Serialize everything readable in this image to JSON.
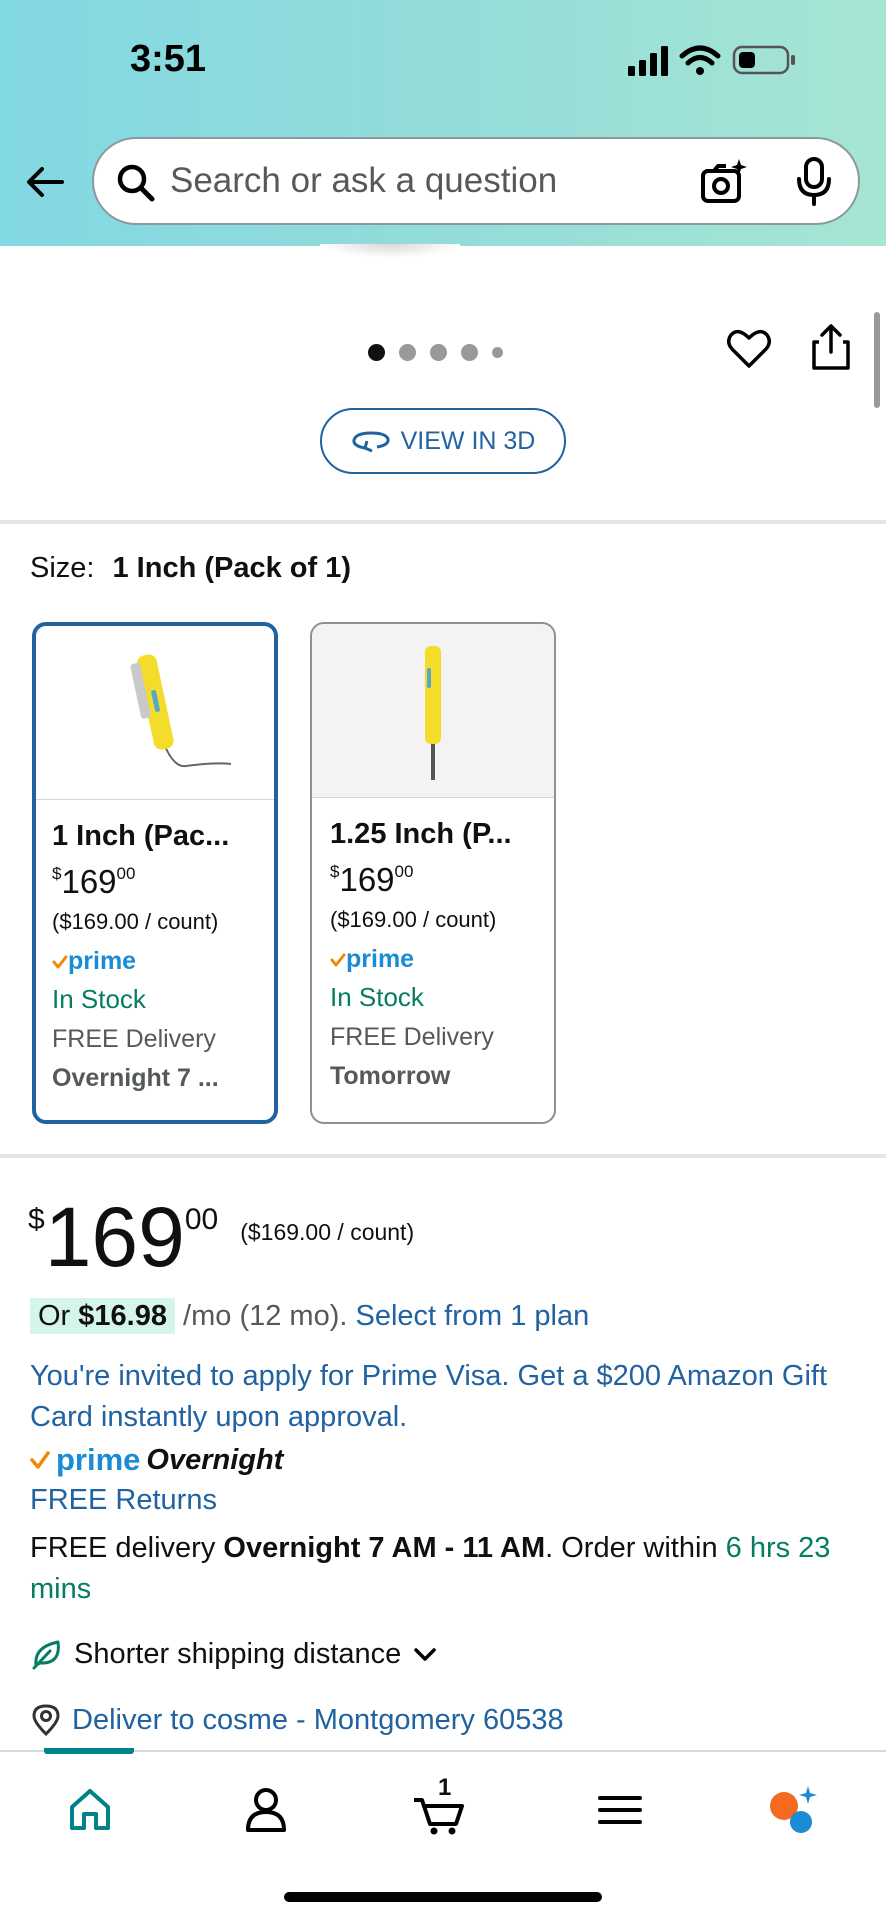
{
  "status_bar": {
    "time": "3:51"
  },
  "search": {
    "placeholder": "Search or ask a question"
  },
  "gallery": {
    "view_3d_label": "VIEW IN 3D",
    "dot_count": 5,
    "active_dot": 0
  },
  "size": {
    "label": "Size:",
    "selected": "1 Inch (Pack of 1)",
    "options": [
      {
        "title": "1 Inch (Pac...",
        "currency": "$",
        "whole": "169",
        "cents": "00",
        "unit_price": "($169.00 / count)",
        "prime": "prime",
        "stock": "In Stock",
        "delivery": "FREE Delivery",
        "date": "Overnight 7 ..."
      },
      {
        "title": "1.25 Inch (P...",
        "currency": "$",
        "whole": "169",
        "cents": "00",
        "unit_price": "($169.00 / count)",
        "prime": "prime",
        "stock": "In Stock",
        "delivery": "FREE Delivery",
        "date": "Tomorrow"
      }
    ]
  },
  "price": {
    "currency": "$",
    "whole": "169",
    "cents": "00",
    "unit_price": "($169.00 / count)"
  },
  "financing": {
    "or": "Or",
    "amount": "$16.98",
    "term": "/mo (12 mo).",
    "link": "Select from 1 plan"
  },
  "prime_visa": "You're invited to apply for Prime Visa. Get a $200 Amazon Gift Card instantly upon approval.",
  "prime_badge": {
    "prime": "prime",
    "speed": "Overnight"
  },
  "returns": "FREE Returns",
  "delivery": {
    "prefix": "FREE delivery",
    "window": "Overnight 7 AM - 11 AM",
    "order_within": ". Order within",
    "countdown": "6 hrs 23 mins"
  },
  "shipping_note": "Shorter shipping distance",
  "deliver_to": "Deliver to cosme - Montgomery 60538",
  "bottom_nav": {
    "cart_count": "1"
  },
  "colors": {
    "link": "#2162a1",
    "green": "#067d62",
    "prime_blue": "#1a8bd5",
    "nav_teal": "#00828a"
  }
}
